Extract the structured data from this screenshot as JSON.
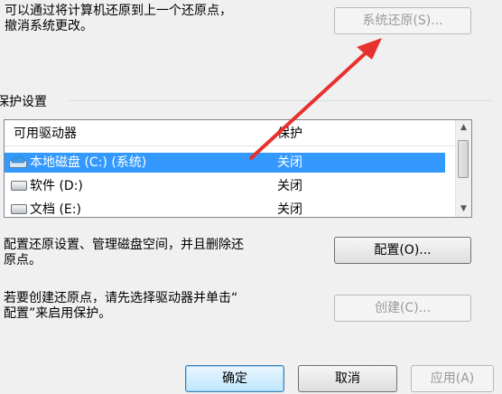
{
  "restore": {
    "description_line1": "可以通过将计算机还原到上一个还原点，",
    "description_line2": "撤消系统更改。",
    "button_label": "系统还原(S)..."
  },
  "protection": {
    "group_title": "保护设置",
    "columns": [
      "可用驱动器",
      "保护"
    ],
    "drives": [
      {
        "name": "本地磁盘 (C:) (系统)",
        "status": "关闭",
        "selected": true,
        "icon": "system-drive-icon"
      },
      {
        "name": "软件 (D:)",
        "status": "关闭",
        "selected": false,
        "icon": "drive-icon"
      },
      {
        "name": "文档 (E:)",
        "status": "关闭",
        "selected": false,
        "icon": "drive-icon"
      }
    ]
  },
  "configure": {
    "description_line1": "配置还原设置、管理磁盘空间，并且删除还",
    "description_line2": "原点。",
    "button_label": "配置(O)..."
  },
  "create": {
    "description_line1": "若要创建还原点，请先选择驱动器并单击“",
    "description_line2": "配置”来启用保护。",
    "button_label": "创建(C)..."
  },
  "footer": {
    "ok_label": "确定",
    "cancel_label": "取消",
    "apply_label": "应用(A)"
  },
  "colors": {
    "selection": "#3399ff",
    "annotation_arrow": "#e8312f"
  }
}
